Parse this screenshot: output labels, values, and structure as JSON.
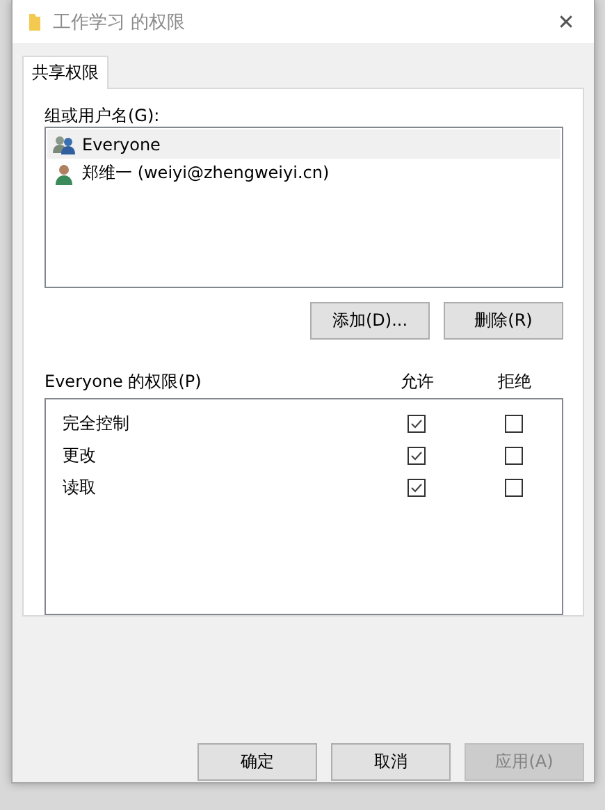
{
  "window": {
    "title": "工作学习 的权限",
    "close": "✕"
  },
  "tabs": [
    {
      "label": "共享权限",
      "selected": true
    }
  ],
  "users_label": "组或用户名(G):",
  "users": [
    {
      "name": "Everyone",
      "kind": "group",
      "selected": true
    },
    {
      "name": "郑维一 (weiyi@zhengweiyi.cn)",
      "kind": "user",
      "selected": false
    }
  ],
  "user_buttons": [
    {
      "label": "添加(D)...",
      "disabled": false
    },
    {
      "label": "删除(R)",
      "disabled": false
    }
  ],
  "permissions": {
    "label": "Everyone 的权限(P)",
    "allow_header": "允许",
    "deny_header": "拒绝",
    "rows": [
      {
        "name": "完全控制",
        "allow": true,
        "deny": false
      },
      {
        "name": "更改",
        "allow": true,
        "deny": false
      },
      {
        "name": "读取",
        "allow": true,
        "deny": false
      }
    ]
  },
  "buttons": [
    {
      "label": "确定",
      "disabled": false
    },
    {
      "label": "取消",
      "disabled": false
    },
    {
      "label": "应用(A)",
      "disabled": true
    }
  ]
}
